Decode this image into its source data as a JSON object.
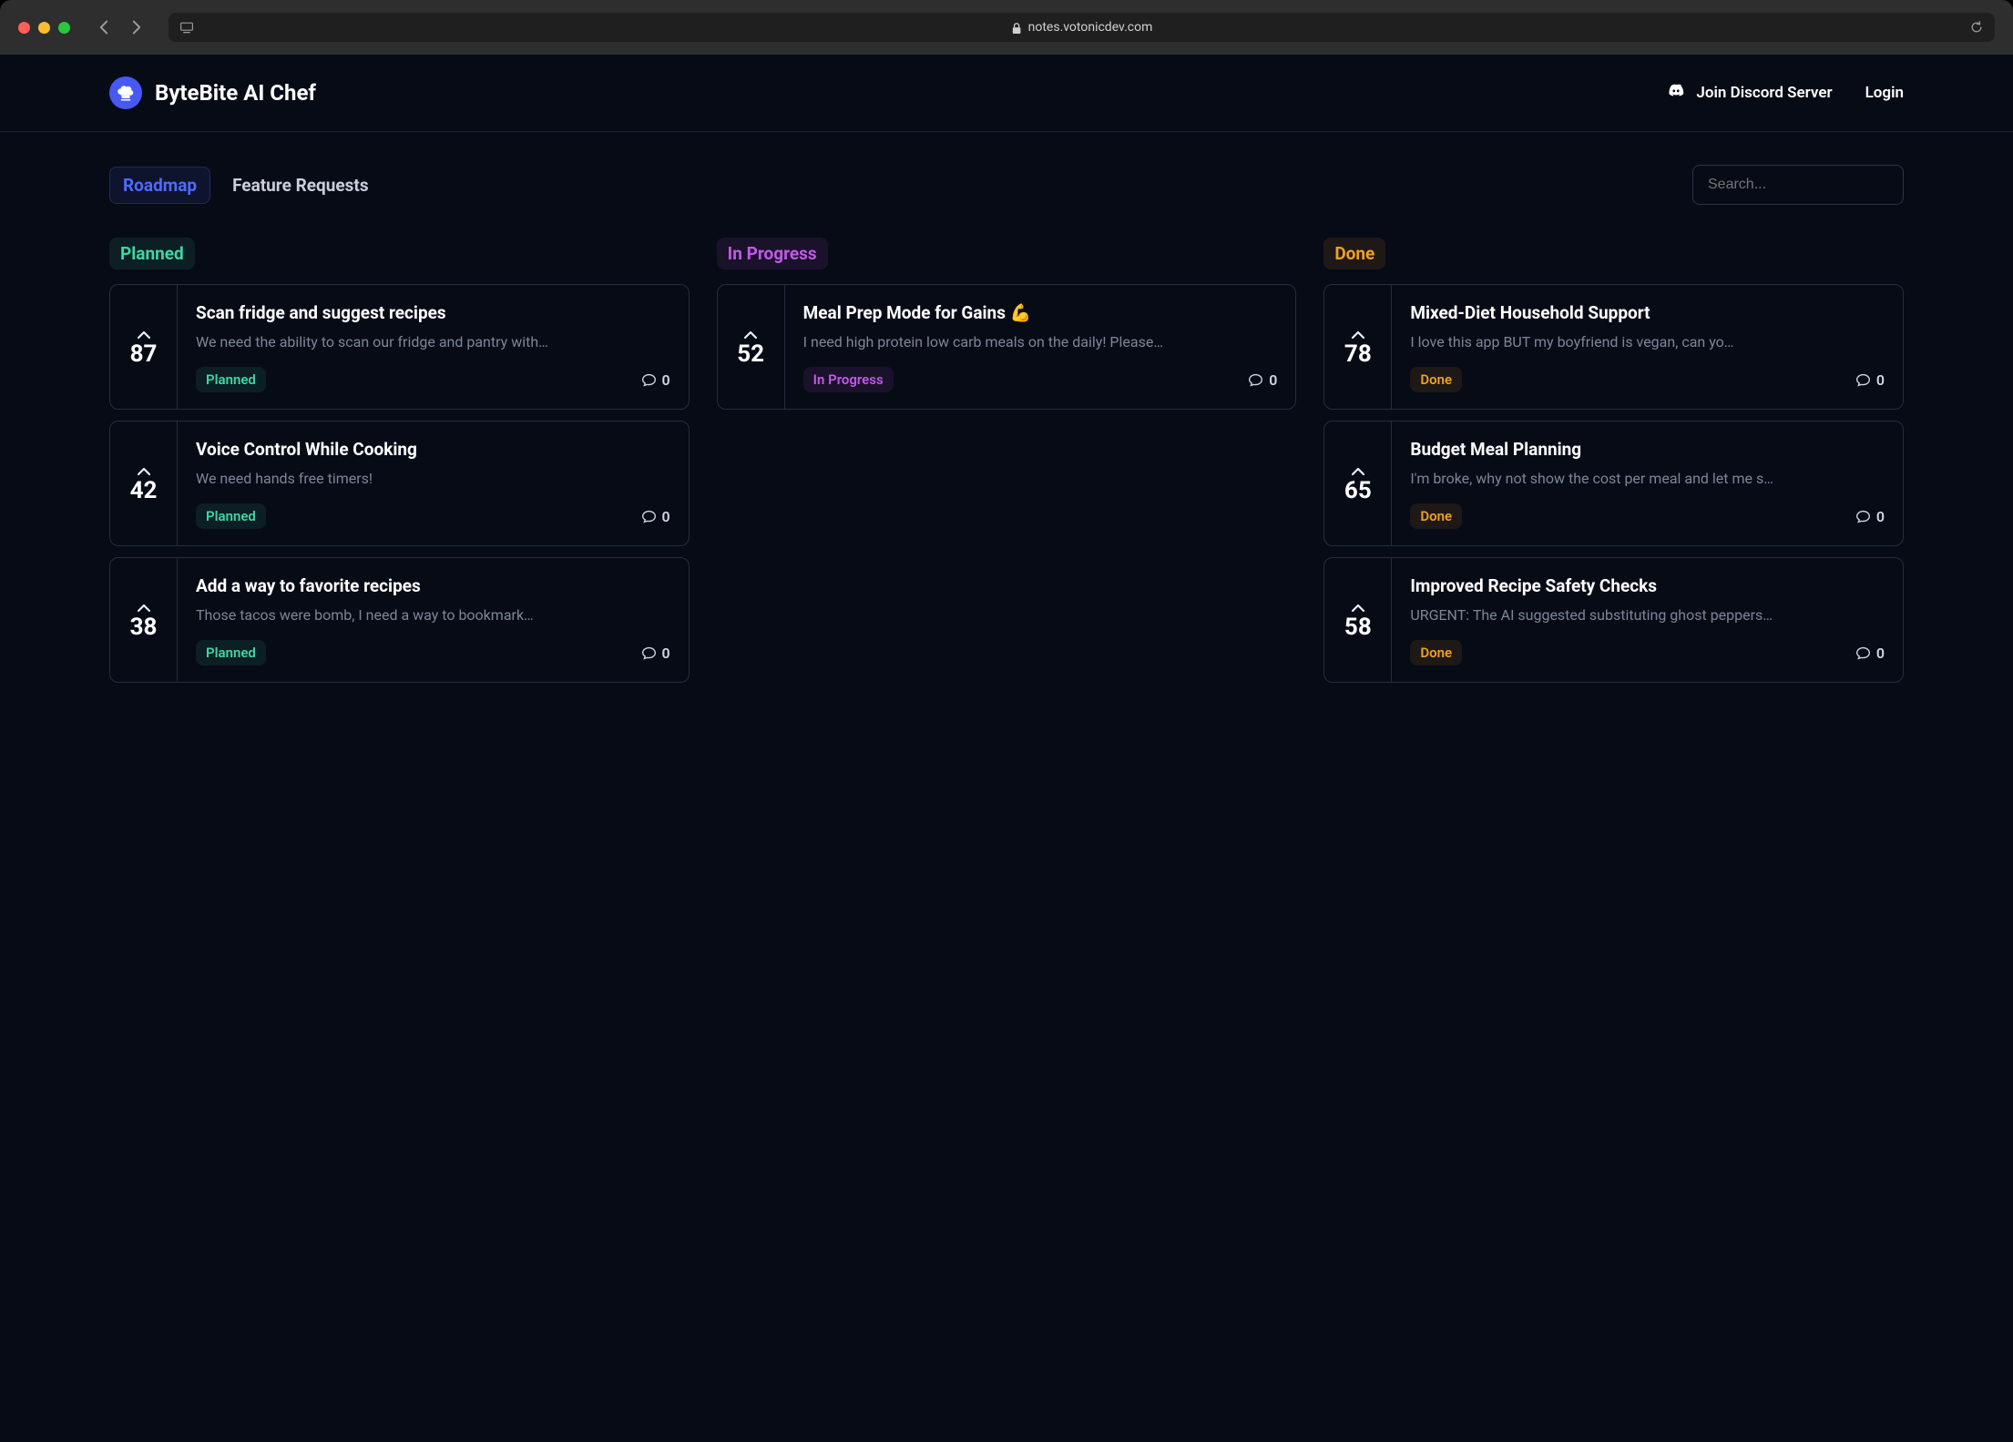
{
  "browser": {
    "url_display": "notes.votonicdev.com"
  },
  "header": {
    "title": "ByteBite AI Chef",
    "discord_label": "Join Discord Server",
    "login_label": "Login"
  },
  "tabs": {
    "roadmap": "Roadmap",
    "feature_requests": "Feature Requests"
  },
  "search": {
    "placeholder": "Search..."
  },
  "columns": {
    "planned": {
      "label": "Planned"
    },
    "inprogress": {
      "label": "In Progress"
    },
    "done": {
      "label": "Done"
    }
  },
  "cards": {
    "planned": [
      {
        "votes": "87",
        "title": "Scan fridge and suggest recipes",
        "desc": "We need the ability to scan our fridge and pantry with…",
        "status": "Planned",
        "comments": "0"
      },
      {
        "votes": "42",
        "title": "Voice Control While Cooking",
        "desc": "We need hands free timers!",
        "status": "Planned",
        "comments": "0"
      },
      {
        "votes": "38",
        "title": "Add a way to favorite recipes",
        "desc": "Those tacos were bomb, I need a way to bookmark…",
        "status": "Planned",
        "comments": "0"
      }
    ],
    "inprogress": [
      {
        "votes": "52",
        "title": "Meal Prep Mode for Gains 💪",
        "desc": "I need high protein low carb meals on the daily! Please…",
        "status": "In Progress",
        "comments": "0"
      }
    ],
    "done": [
      {
        "votes": "78",
        "title": "Mixed-Diet Household Support",
        "desc": "I love this app BUT my boyfriend is vegan, can yo…",
        "status": "Done",
        "comments": "0"
      },
      {
        "votes": "65",
        "title": "Budget Meal Planning",
        "desc": "I'm broke, why not show the cost per meal and let me s…",
        "status": "Done",
        "comments": "0"
      },
      {
        "votes": "58",
        "title": "Improved Recipe Safety Checks",
        "desc": "URGENT: The AI suggested substituting ghost peppers…",
        "status": "Done",
        "comments": "0"
      }
    ]
  }
}
